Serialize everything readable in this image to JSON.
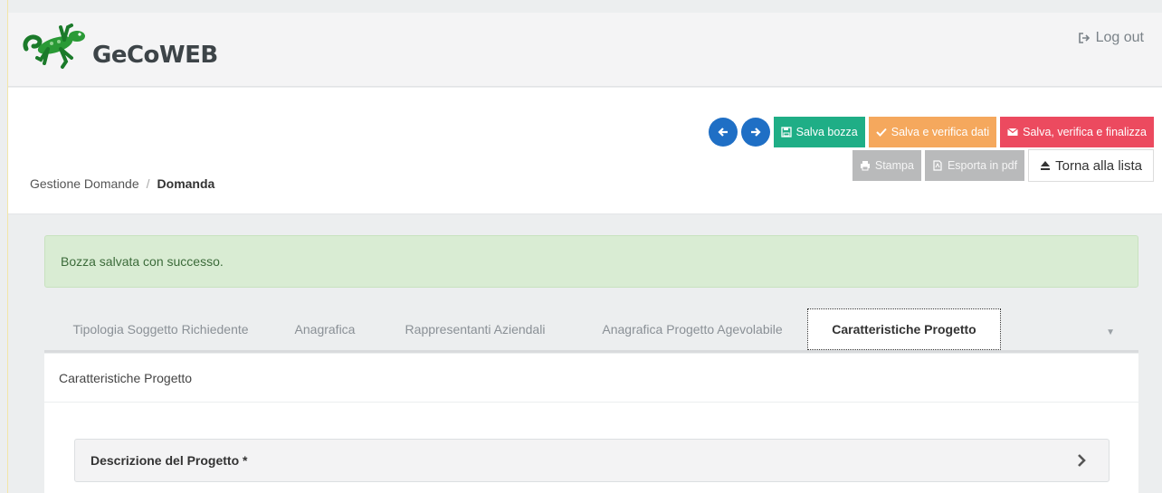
{
  "header": {
    "brand": "GeCoWEB",
    "logout_label": "Log out",
    "logo_icon": "gecko-logo-icon"
  },
  "breadcrumb": {
    "parent": "Gestione Domande",
    "separator": "/",
    "current": "Domanda"
  },
  "toolbar": {
    "prev_icon": "arrow-left-icon",
    "next_icon": "arrow-right-icon",
    "save_draft": "Salva bozza",
    "save_verify": "Salva e verifica dati",
    "save_finalize": "Salva, verifica e finalizza",
    "print": "Stampa",
    "export_pdf": "Esporta in pdf",
    "back_to_list": "Torna alla lista"
  },
  "alert": {
    "message": "Bozza salvata con successo."
  },
  "tabs": [
    {
      "label": "Tipologia Soggetto Richiedente"
    },
    {
      "label": "Anagrafica"
    },
    {
      "label": "Rappresentanti Aziendali"
    },
    {
      "label": "Anagrafica Progetto Agevolabile"
    },
    {
      "label": "Caratteristiche Progetto",
      "active": true
    }
  ],
  "panel": {
    "title": "Caratteristiche Progetto",
    "section_title": "Descrizione del Progetto *"
  },
  "colors": {
    "primary": "#1f6fc5",
    "success": "#1fae86",
    "warning": "#f5a85d",
    "danger": "#ec4a5f",
    "alert_bg": "#d9ecd3"
  }
}
